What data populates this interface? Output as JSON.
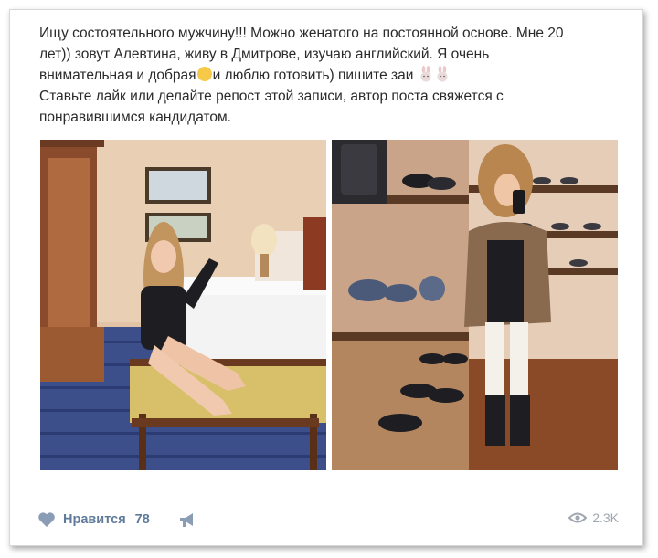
{
  "post": {
    "line1": "Ищу состоятельного мужчину!!! Можно женатого на постоянной основе. Мне 20",
    "line2": "лет)) зовут Алевтина, живу в Дмитрове, изучаю английский. Я очень",
    "line3a": "внимательная и добрая",
    "line3b": "и люблю готовить) пишите заи",
    "line4": "Ставьте лайк или делайте репост этой записи, автор поста свяжется с",
    "line5": "понравившимся кандидатом."
  },
  "photos": [
    {
      "name": "photo-hotel-room"
    },
    {
      "name": "photo-shoe-store"
    }
  ],
  "footer": {
    "like_label": "Нравится",
    "like_count": "78",
    "views_count": "2.3K"
  },
  "icons": {
    "like": "heart-icon",
    "share": "megaphone-icon",
    "views": "eye-icon"
  },
  "colors": {
    "action_text": "#5f7a9a",
    "muted": "#a0a7b1"
  }
}
